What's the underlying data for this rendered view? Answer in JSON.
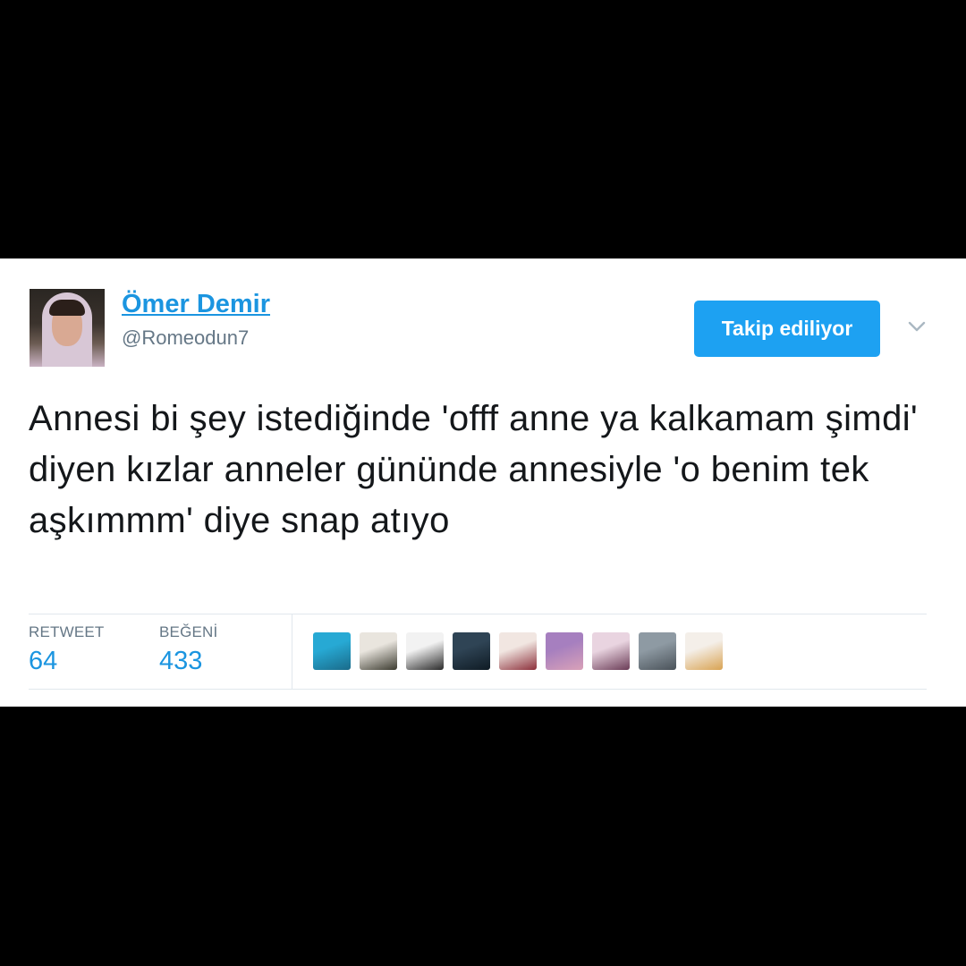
{
  "author": {
    "display_name": "Ömer Demir",
    "handle": "@Romeodun7",
    "avatar_icon": "user-avatar"
  },
  "follow_button": {
    "label": "Takip ediliyor"
  },
  "menu": {
    "icon": "chevron-down-icon"
  },
  "tweet": {
    "text": "Annesi bi şey istediğinde 'offf anne ya kalkamam şimdi' diyen kızlar anneler gününde annesiyle 'o benim tek aşkımmm' diye snap atıyo"
  },
  "stats": {
    "retweet_label": "RETWEET",
    "retweet_count": "64",
    "like_label": "BEĞENİ",
    "like_count": "433"
  },
  "likers": [
    {
      "colors": [
        "#27a9d4",
        "#1a6b8a"
      ]
    },
    {
      "colors": [
        "#e9e5de",
        "#3b3a2f"
      ]
    },
    {
      "colors": [
        "#f2f2f2",
        "#2a2a2a"
      ]
    },
    {
      "colors": [
        "#2f4455",
        "#0f1b24"
      ]
    },
    {
      "colors": [
        "#f1e6e1",
        "#8c2f3a"
      ]
    },
    {
      "colors": [
        "#a67fbf",
        "#d9a1b8"
      ]
    },
    {
      "colors": [
        "#e9d4e0",
        "#6a3b56"
      ]
    },
    {
      "colors": [
        "#8e9aa3",
        "#4a5259"
      ]
    },
    {
      "colors": [
        "#f4efe9",
        "#d9a352"
      ]
    }
  ],
  "colors": {
    "accent": "#1b95e0",
    "button": "#1da1f2",
    "text": "#14171a",
    "muted": "#657786"
  }
}
